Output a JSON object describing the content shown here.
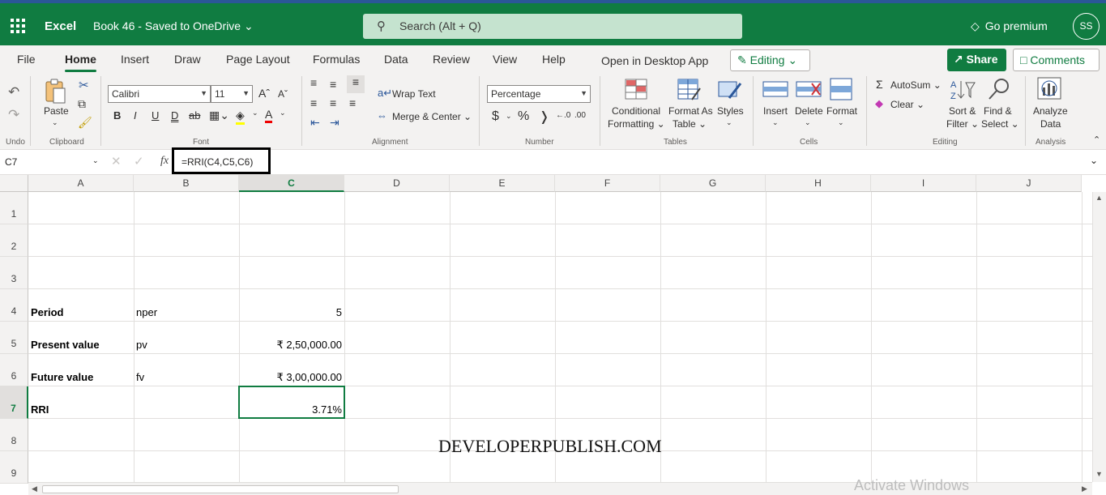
{
  "app": {
    "name": "Excel",
    "doc_title": "Book 46  -  Saved to OneDrive ⌄",
    "search_placeholder": "Search (Alt + Q)",
    "premium": "Go premium",
    "avatar": "SS"
  },
  "menu": {
    "tabs": [
      "File",
      "Home",
      "Insert",
      "Draw",
      "Page Layout",
      "Formulas",
      "Data",
      "Review",
      "View",
      "Help",
      "Open in Desktop App"
    ],
    "editing": "Editing ⌄",
    "share": "Share",
    "comments": "Comments"
  },
  "ribbon": {
    "undo_label": "Undo",
    "clipboard_label": "Clipboard",
    "paste": "Paste",
    "font_label": "Font",
    "font_name": "Calibri",
    "font_size": "11",
    "alignment_label": "Alignment",
    "wrap_text": "Wrap Text",
    "merge_center": "Merge & Center ⌄",
    "number_label": "Number",
    "number_format": "Percentage",
    "tables_label": "Tables",
    "conditional": "Conditional",
    "formatting": "Formatting ⌄",
    "format_as": "Format As",
    "table": "Table ⌄",
    "styles": "Styles",
    "cells_label": "Cells",
    "insert": "Insert",
    "delete": "Delete",
    "format": "Format",
    "editing_label": "Editing",
    "autosum": "AutoSum ⌄",
    "clear": "Clear ⌄",
    "sort": "Sort &",
    "filter": "Filter ⌄",
    "find": "Find &",
    "select": "Select ⌄",
    "analysis_label": "Analysis",
    "analyze": "Analyze",
    "data": "Data"
  },
  "formula_bar": {
    "name_box": "C7",
    "fx": "fx",
    "formula": "=RRI(C4,C5,C6)"
  },
  "columns": [
    "A",
    "B",
    "C",
    "D",
    "E",
    "F",
    "G",
    "H",
    "I",
    "J"
  ],
  "rows": [
    "1",
    "2",
    "3",
    "4",
    "5",
    "6",
    "7",
    "8",
    "9"
  ],
  "cells": {
    "A4": "Period",
    "B4": "nper",
    "C4": "5",
    "A5": "Present value",
    "B5": "pv",
    "C5": "₹ 2,50,000.00",
    "A6": "Future value",
    "B6": "fv",
    "C6": "₹ 3,00,000.00",
    "A7": "RRI",
    "C7": "3.71%"
  },
  "watermark": "DEVELOPERPUBLISH.COM",
  "activate": "Activate Windows",
  "colors": {
    "accent": "#107c41",
    "search_bg": "#c5e3cf"
  }
}
